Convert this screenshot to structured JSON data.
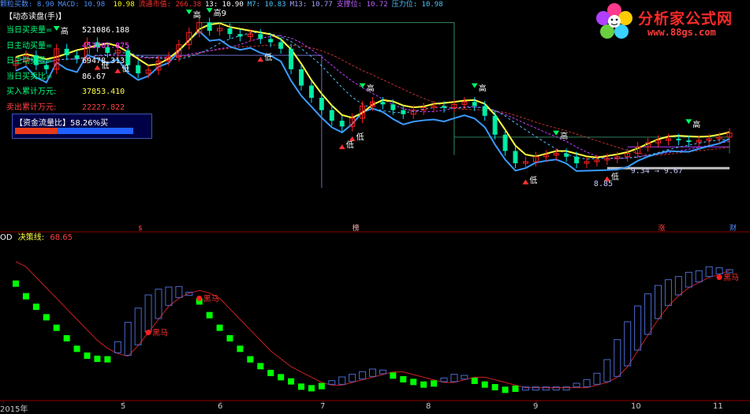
{
  "topbar": {
    "items": [
      {
        "label": "颗粒买数:",
        "value": "8.90",
        "color": "#4f8fff"
      },
      {
        "label": "MACD:",
        "value": "10.98",
        "color": "#4f8fff"
      },
      {
        "label": "",
        "value": "10.98",
        "color": "#ffff00"
      },
      {
        "label": "流通市值:",
        "value": "266.38",
        "color": "#ff3030"
      },
      {
        "label": "13:",
        "value": "10.90",
        "color": "#ffffff"
      },
      {
        "label": "M7:",
        "value": "10.83",
        "color": "#4fc3ff"
      },
      {
        "label": "M13:",
        "value": "10.77",
        "color": "#a0a0ff"
      },
      {
        "label": "支撑位:",
        "value": "10.72",
        "color": "#c060ff"
      },
      {
        "label": "压力位:",
        "value": "10.98",
        "color": "#4fc3ff"
      }
    ]
  },
  "info_panel": {
    "title": "【动态读盘(手)】",
    "rows": [
      {
        "label": "当日买卖量=",
        "value": "521086.188",
        "label_color": "#00ff80",
        "value_color": "#ffffff"
      },
      {
        "label": "日主动买量=",
        "value": "451607.875",
        "label_color": "#00ff80",
        "value_color": "#ff40ff"
      },
      {
        "label": "日主动卖量=",
        "value": "69478.313",
        "label_color": "#00ff80",
        "value_color": "#ffffff"
      },
      {
        "label": "当日买卖比=",
        "value": "86.67",
        "label_color": "#00ff80",
        "value_color": "#ffffff"
      },
      {
        "label": "买入累计万元:",
        "value": "37853.410",
        "label_color": "#00ff80",
        "value_color": "#ffff40"
      },
      {
        "label": "卖出累计万元:",
        "value": "22227.822",
        "label_color": "#ff4040",
        "value_color": "#ff4040"
      }
    ],
    "flow_ratio_label": "【资金流量比】",
    "flow_ratio_value": "58.26%买",
    "flow_ratio_fraction": 0.58
  },
  "logo": {
    "text": "分析家公式网",
    "url": "www.88gs.com"
  },
  "main_annotations": {
    "high_label": "高",
    "low_label": "低",
    "high9_label": "高9",
    "range_label": "9.34 → 9.67",
    "price_low": "8.85",
    "event_labels": [
      {
        "text": "$",
        "color": "#ff4040",
        "x_index": 12
      },
      {
        "text": "榜",
        "color": "#ffb0b0",
        "x_index": 33
      },
      {
        "text": "涨",
        "color": "#ff4040",
        "x_index": 63
      },
      {
        "text": "财",
        "color": "#4f8fff",
        "x_index": 70
      }
    ]
  },
  "sub_panel": {
    "prefix": "OD",
    "title": "决策线:",
    "value": "68.65",
    "signal_label": "黑马"
  },
  "x_axis": {
    "labels": [
      "2015年",
      "5",
      "6",
      "7",
      "8",
      "9",
      "10",
      "11"
    ]
  },
  "colors": {
    "up": "#ff2020",
    "down": "#00e0ff",
    "ma_yellow": "#ffff40",
    "ma_blue": "#3a9bff",
    "signal_green": "#00ff00",
    "step_blue": "#4a6ad0",
    "decision_red": "#d02020"
  },
  "chart_data": {
    "type": "candlestick",
    "price_scale_hint": [
      8.5,
      11.2
    ],
    "closes": [
      10.55,
      10.62,
      10.5,
      10.45,
      10.7,
      10.62,
      10.58,
      10.78,
      10.72,
      10.65,
      10.68,
      10.5,
      10.4,
      10.44,
      10.55,
      10.6,
      10.75,
      10.9,
      11.02,
      10.92,
      10.95,
      10.88,
      10.85,
      10.88,
      10.82,
      10.78,
      10.7,
      10.45,
      10.25,
      10.1,
      9.95,
      9.82,
      9.75,
      9.85,
      10.0,
      10.05,
      10.02,
      9.95,
      9.9,
      9.95,
      9.98,
      10.0,
      9.98,
      10.02,
      10.05,
      10.0,
      9.88,
      9.65,
      9.45,
      9.3,
      9.32,
      9.38,
      9.4,
      9.42,
      9.38,
      9.3,
      9.32,
      9.34,
      9.36,
      9.38,
      9.42,
      9.5,
      9.55,
      9.58,
      9.6,
      9.58,
      9.56,
      9.58,
      9.6,
      9.62,
      9.67
    ],
    "decision_line": [
      72,
      70,
      66,
      62,
      58,
      54,
      50,
      46,
      42,
      39,
      37,
      36,
      40,
      45,
      50,
      55,
      58,
      60,
      61,
      60,
      58,
      54,
      50,
      46,
      42,
      38,
      35,
      32,
      30,
      28,
      26,
      25,
      25,
      26,
      27,
      28,
      29,
      30,
      30,
      29,
      28,
      27,
      26,
      26,
      27,
      28,
      28,
      27,
      26,
      25,
      24,
      24,
      24,
      24,
      24,
      24,
      24,
      25,
      26,
      28,
      32,
      38,
      44,
      50,
      55,
      59,
      62,
      64,
      66,
      67,
      68.65
    ]
  }
}
